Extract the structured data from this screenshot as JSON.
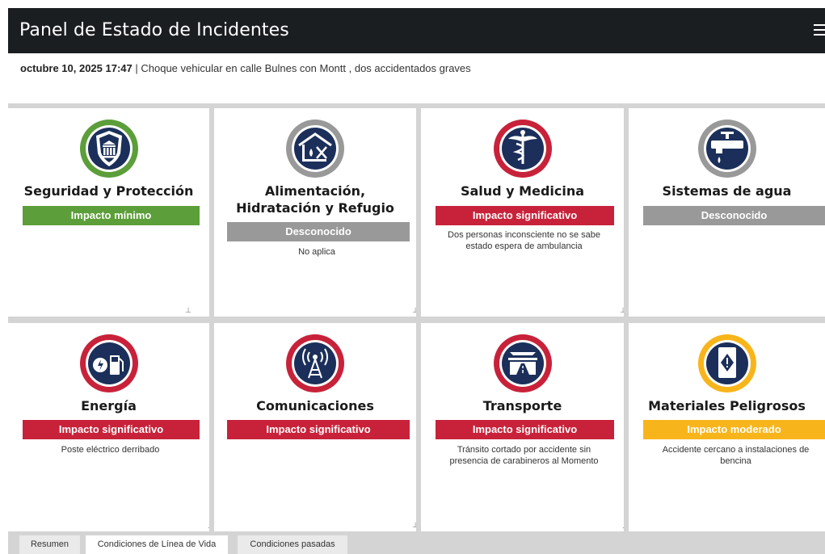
{
  "header": {
    "title": "Panel de Estado de Incidentes"
  },
  "incident": {
    "datetime": "octubre 10, 2025 17:47",
    "separator": " | ",
    "description": "Choque vehicular en calle Bulnes con Montt , dos accidentados graves"
  },
  "colors": {
    "green": "#5c9e3a",
    "red": "#c8223a",
    "gray": "#999999",
    "yellow": "#f8b51b",
    "navy": "#1b2f5a"
  },
  "cards": [
    {
      "name": "Seguridad y Protección",
      "status": "Impacto mínimo",
      "status_color": "green",
      "note": "",
      "icon": "police-badge-icon"
    },
    {
      "name": "Alimentación, Hidratación y Refugio",
      "status": "Desconocido",
      "status_color": "gray",
      "note": "No aplica",
      "icon": "shelter-food-icon"
    },
    {
      "name": "Salud y Medicina",
      "status": "Impacto significativo",
      "status_color": "red",
      "note": "Dos personas inconsciente no se sabe estado espera de ambulancia",
      "icon": "caduceus-icon"
    },
    {
      "name": "Sistemas de agua",
      "status": "Desconocido",
      "status_color": "gray",
      "note": "",
      "icon": "water-faucet-icon"
    },
    {
      "name": "Energía",
      "status": "Impacto significativo",
      "status_color": "red",
      "note": "Poste eléctrico derribado",
      "icon": "energy-fuel-icon"
    },
    {
      "name": "Comunicaciones",
      "status": "Impacto significativo",
      "status_color": "red",
      "note": "",
      "icon": "radio-tower-icon"
    },
    {
      "name": "Transporte",
      "status": "Impacto significativo",
      "status_color": "red",
      "note": "Tránsito cortado por accidente sin presencia de carabineros al Momento",
      "icon": "transport-icon"
    },
    {
      "name": "Materiales Peligrosos",
      "status": "Impacto moderado",
      "status_color": "yellow",
      "note": "Accidente cercano a instalaciones de bencina",
      "icon": "hazmat-barrel-icon"
    }
  ],
  "tabs": [
    {
      "label": "Resumen",
      "active": false
    },
    {
      "label": "Condiciones de Línea de Vida",
      "active": true
    },
    {
      "label": "Condiciones pasadas",
      "active": false
    }
  ]
}
